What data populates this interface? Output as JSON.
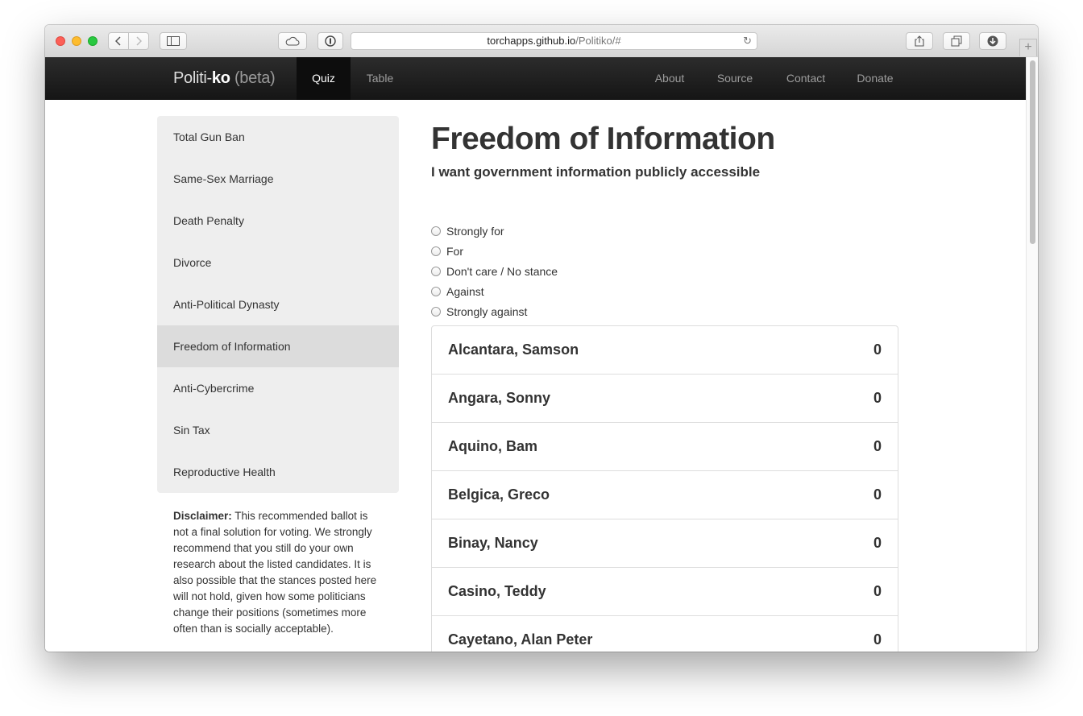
{
  "browser": {
    "url_host": "torchapps.github.io",
    "url_path": "/Politiko/#"
  },
  "navbar": {
    "brand_main": "Politi-",
    "brand_bold": "ko",
    "brand_beta": "(beta)",
    "items": [
      "Quiz",
      "Table",
      "About",
      "Source",
      "Contact",
      "Donate"
    ]
  },
  "topics": [
    "Total Gun Ban",
    "Same-Sex Marriage",
    "Death Penalty",
    "Divorce",
    "Anti-Political Dynasty",
    "Freedom of Information",
    "Anti-Cybercrime",
    "Sin Tax",
    "Reproductive Health"
  ],
  "active_topic": "Freedom of Information",
  "disclaimer": {
    "label": "Disclaimer:",
    "text": " This recommended ballot is not a final solution for voting. We strongly recommend that you still do your own research about the listed candidates. It is also possible that the stances posted here will not hold, given how some politicians change their positions (sometimes more often than is socially acceptable)."
  },
  "question": {
    "title": "Freedom of Information",
    "subtitle": "I want government information publicly accessible",
    "options": [
      "Strongly for",
      "For",
      "Don't care / No stance",
      "Against",
      "Strongly against"
    ]
  },
  "candidates": [
    {
      "name": "Alcantara, Samson",
      "score": "0"
    },
    {
      "name": "Angara, Sonny",
      "score": "0"
    },
    {
      "name": "Aquino, Bam",
      "score": "0"
    },
    {
      "name": "Belgica, Greco",
      "score": "0"
    },
    {
      "name": "Binay, Nancy",
      "score": "0"
    },
    {
      "name": "Casino, Teddy",
      "score": "0"
    },
    {
      "name": "Cayetano, Alan Peter",
      "score": "0"
    }
  ]
}
